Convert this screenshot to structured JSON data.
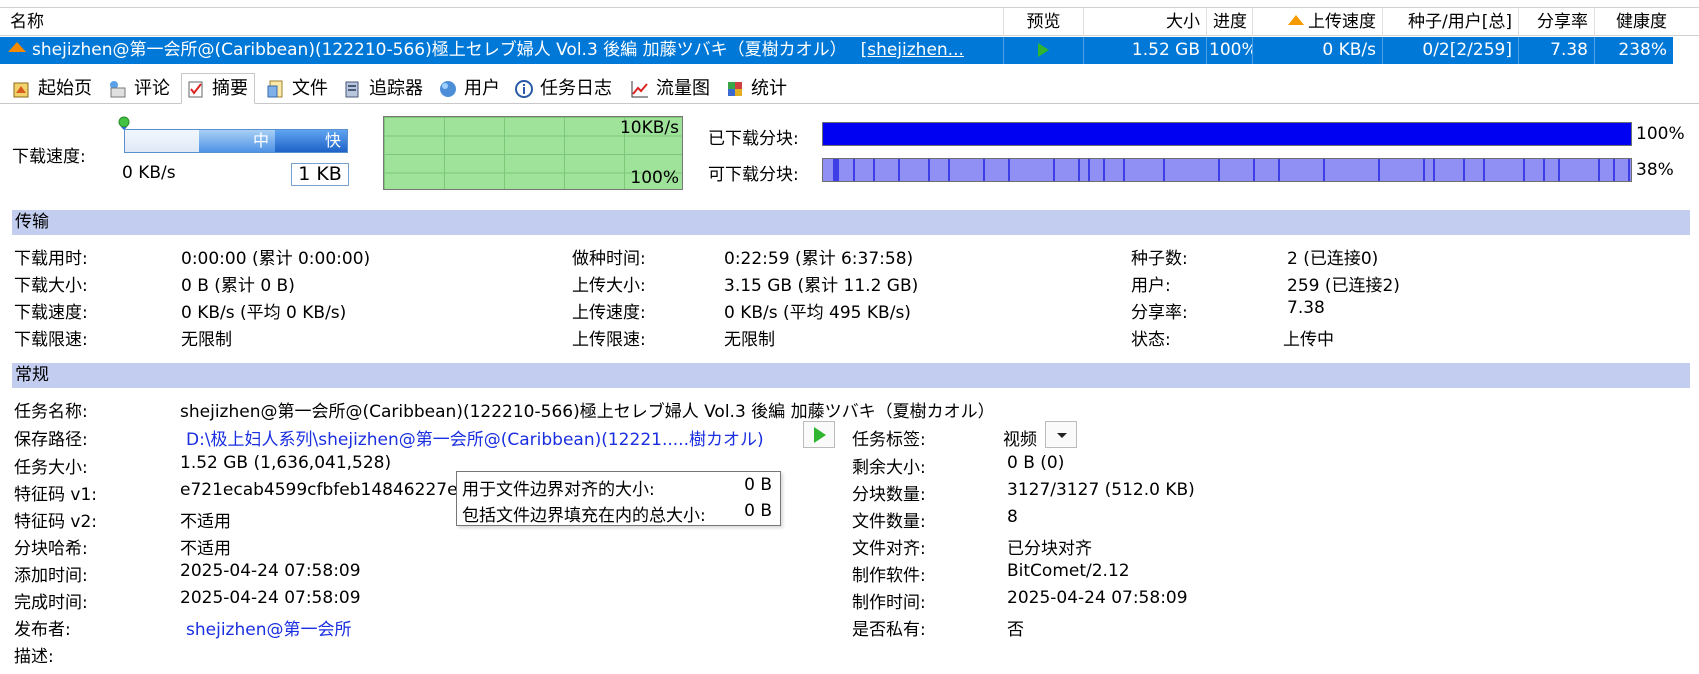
{
  "list": {
    "headers": {
      "name": "名称",
      "preview": "预览",
      "size": "大小",
      "progress": "进度",
      "upload_speed": "上传速度",
      "peers": "种子/用户[总]",
      "share_ratio": "分享率",
      "health": "健康度"
    },
    "row": {
      "name": "shejizhen@第一会所@(Caribbean)(122210-566)極上セレブ婦人 Vol.3 後編 加藤ツバキ（夏樹カオル）",
      "name_link": "[shejizhen...",
      "size": "1.52 GB",
      "progress": "100%",
      "upload_speed": "0 KB/s",
      "peers": "0/2[2/259]",
      "share_ratio": "7.38",
      "health": "238%"
    }
  },
  "tabs": [
    {
      "label": "起始页",
      "icon": "home-page-icon"
    },
    {
      "label": "评论",
      "icon": "comment-icon"
    },
    {
      "label": "摘要",
      "icon": "summary-icon"
    },
    {
      "label": "文件",
      "icon": "file-icon"
    },
    {
      "label": "追踪器",
      "icon": "tracker-icon"
    },
    {
      "label": "用户",
      "icon": "users-icon"
    },
    {
      "label": "任务日志",
      "icon": "info-icon"
    },
    {
      "label": "流量图",
      "icon": "traffic-chart-icon"
    },
    {
      "label": "统计",
      "icon": "statistics-icon"
    }
  ],
  "speed": {
    "label": "下载速度:",
    "current": "0 KB/s",
    "slider_mid": "中",
    "slider_fast": "快",
    "limit_value": "1 KB",
    "graph_top": "10KB/s",
    "graph_bottom": "100%"
  },
  "pieces": {
    "downloaded_label": "已下载分块:",
    "downloaded_pct": "100%",
    "downloaded_fraction": 1.0,
    "available_label": "可下载分块:",
    "available_pct": "38%",
    "available_fraction": 0.38
  },
  "transfer": {
    "title": "传输",
    "col1": [
      {
        "k": "下载用时:",
        "v": "0:00:00 (累计 0:00:00)"
      },
      {
        "k": "下载大小:",
        "v": "0 B (累计 0 B)"
      },
      {
        "k": "下载速度:",
        "v": "0 KB/s (平均 0 KB/s)"
      },
      {
        "k": "下载限速:",
        "v": "无限制"
      }
    ],
    "col2": [
      {
        "k": "做种时间:",
        "v": "0:22:59 (累计 6:37:58)"
      },
      {
        "k": "上传大小:",
        "v": "3.15 GB (累计 11.2 GB)"
      },
      {
        "k": "上传速度:",
        "v": "0 KB/s (平均 495 KB/s)"
      },
      {
        "k": "上传限速:",
        "v": "无限制"
      }
    ],
    "col3": [
      {
        "k": "种子数:",
        "v": "2 (已连接0)"
      },
      {
        "k": "用户:",
        "v": "259 (已连接2)"
      },
      {
        "k": "分享率:",
        "v": "7.38"
      },
      {
        "k": "状态:",
        "v": "上传中"
      }
    ]
  },
  "general": {
    "title": "常规",
    "task_name_k": "任务名称:",
    "task_name_v": "shejizhen@第一会所@(Caribbean)(122210-566)極上セレブ婦人 Vol.3 後編 加藤ツバキ（夏樹カオル）",
    "save_path_k": "保存路径:",
    "save_path_v": "D:\\极上妇人系列\\shejizhen@第一会所@(Caribbean)(12221.....樹カオル)",
    "task_tag_k": "任务标签:",
    "task_tag_v": "视频",
    "left": [
      {
        "k": "任务大小:",
        "v": "1.52 GB (1,636,041,528)"
      },
      {
        "k": "特征码 v1:",
        "v": "e721ecab4599cfbfeb14846227e"
      },
      {
        "k": "特征码 v2:",
        "v": "不适用"
      },
      {
        "k": "分块哈希:",
        "v": "不适用"
      },
      {
        "k": "添加时间:",
        "v": "2025-04-24 07:58:09"
      },
      {
        "k": "完成时间:",
        "v": "2025-04-24 07:58:09"
      }
    ],
    "publisher_k": "发布者:",
    "publisher_v": "shejizhen@第一会所",
    "desc_k": "描述:",
    "right": [
      {
        "k": "剩余大小:",
        "v": "0 B (0)"
      },
      {
        "k": "分块数量:",
        "v": "3127/3127 (512.0 KB)"
      },
      {
        "k": "文件数量:",
        "v": "8"
      },
      {
        "k": "文件对齐:",
        "v": "已分块对齐"
      },
      {
        "k": "制作软件:",
        "v": "BitComet/2.12"
      },
      {
        "k": "制作时间:",
        "v": "2025-04-24 07:58:09"
      },
      {
        "k": "是否私有:",
        "v": "否"
      }
    ]
  },
  "tooltip": {
    "row1_k": "用于文件边界对齐的大小:",
    "row1_v": "0 B",
    "row2_k": "包括文件边界填充在内的总大小:",
    "row2_v": "0 B"
  },
  "colors": {
    "selection": "#0078d7",
    "section_header": "#c3cdf0",
    "downloaded_bar": "#0000f2",
    "available_bar": "#8f8ff4",
    "graph_bg": "#9fe29a",
    "link": "#1a2fe0"
  }
}
